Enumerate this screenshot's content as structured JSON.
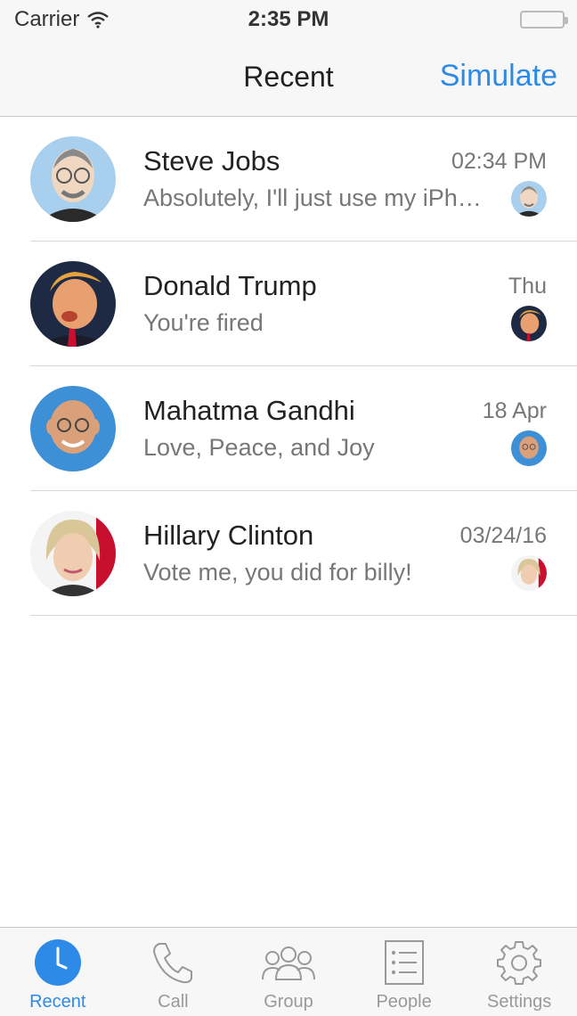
{
  "status_bar": {
    "carrier": "Carrier",
    "time": "2:35 PM"
  },
  "nav": {
    "title": "Recent",
    "action": "Simulate"
  },
  "conversations": [
    {
      "name": "Steve Jobs",
      "preview": "Absolutely, I'll just use my iPhone",
      "time": "02:34 PM",
      "avatar": "steve-jobs-avatar"
    },
    {
      "name": "Donald Trump",
      "preview": "You're fired",
      "time": "Thu",
      "avatar": "donald-trump-avatar"
    },
    {
      "name": "Mahatma Gandhi",
      "preview": "Love, Peace, and Joy",
      "time": "18 Apr",
      "avatar": "mahatma-gandhi-avatar"
    },
    {
      "name": "Hillary Clinton",
      "preview": "Vote me, you did for billy!",
      "time": "03/24/16",
      "avatar": "hillary-clinton-avatar"
    }
  ],
  "tabs": [
    {
      "label": "Recent",
      "icon": "clock-icon",
      "active": true
    },
    {
      "label": "Call",
      "icon": "phone-icon",
      "active": false
    },
    {
      "label": "Group",
      "icon": "group-icon",
      "active": false
    },
    {
      "label": "People",
      "icon": "list-icon",
      "active": false
    },
    {
      "label": "Settings",
      "icon": "gear-icon",
      "active": false
    }
  ],
  "colors": {
    "accent": "#2d8ae6",
    "secondary_text": "#777777",
    "separator": "#d6d6d6",
    "bar_background": "#f7f7f7"
  }
}
